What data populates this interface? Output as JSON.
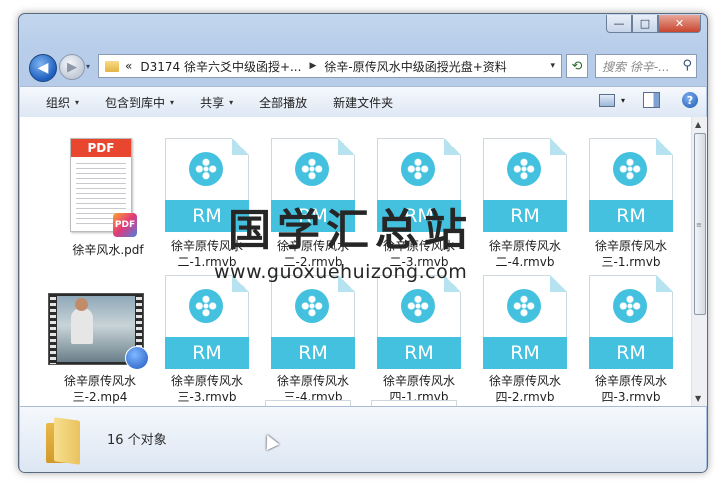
{
  "window": {
    "caption": {
      "minimize_glyph": "—",
      "maximize_glyph": "□",
      "close_glyph": "✕"
    }
  },
  "nav": {
    "back_icon": "back-arrow-icon",
    "forward_icon": "forward-arrow-icon",
    "history_glyph": "▾",
    "address": {
      "overflow_glyph": "«",
      "crumb1": "D3174 徐辛六爻中级函授+...",
      "sep_glyph": "▶",
      "crumb2": "徐辛-原传风水中级函授光盘+资料",
      "drop_glyph": "▾"
    },
    "refresh_glyph": "⟲",
    "search": {
      "placeholder": "搜索 徐辛-...",
      "icon_glyph": "⚲"
    }
  },
  "toolbar": {
    "organize": "组织",
    "include_library": "包含到库中",
    "share": "共享",
    "play_all": "全部播放",
    "new_folder": "新建文件夹",
    "caret_glyph": "▾",
    "help_glyph": "?"
  },
  "files": [
    {
      "name": "徐辛风水.pdf",
      "type": "pdf",
      "icon_head": "PDF",
      "icon_badge": "PDF"
    },
    {
      "name": "徐辛原传风水二-1.rmvb",
      "type": "rmvb",
      "band": "RM"
    },
    {
      "name": "徐辛原传风水二-2.rmvb",
      "type": "rmvb",
      "band": "RM"
    },
    {
      "name": "徐辛原传风水二-3.rmvb",
      "type": "rmvb",
      "band": "RM"
    },
    {
      "name": "徐辛原传风水二-4.rmvb",
      "type": "rmvb",
      "band": "RM"
    },
    {
      "name": "徐辛原传风水三-1.rmvb",
      "type": "rmvb",
      "band": "RM"
    },
    {
      "name": "徐辛原传风水三-2.mp4",
      "type": "mp4"
    },
    {
      "name": "徐辛原传风水三-3.rmvb",
      "type": "rmvb",
      "band": "RM"
    },
    {
      "name": "徐辛原传风水三-4.rmvb",
      "type": "rmvb",
      "band": "RM"
    },
    {
      "name": "徐辛原传风水四-1.rmvb",
      "type": "rmvb",
      "band": "RM"
    },
    {
      "name": "徐辛原传风水四-2.rmvb",
      "type": "rmvb",
      "band": "RM"
    },
    {
      "name": "徐辛原传风水四-3.rmvb",
      "type": "rmvb",
      "band": "RM"
    }
  ],
  "watermark": {
    "title": "国学汇总站",
    "url": "www.guoxuehuizong.com"
  },
  "details": {
    "count": "16 个对象"
  },
  "scrollbar": {
    "up_glyph": "▲",
    "down_glyph": "▼",
    "grip_glyph": "≡"
  },
  "colors": {
    "rm_accent": "#43c1df",
    "pdf_red": "#e8462e",
    "chrome_blue": "#b7cde9"
  }
}
